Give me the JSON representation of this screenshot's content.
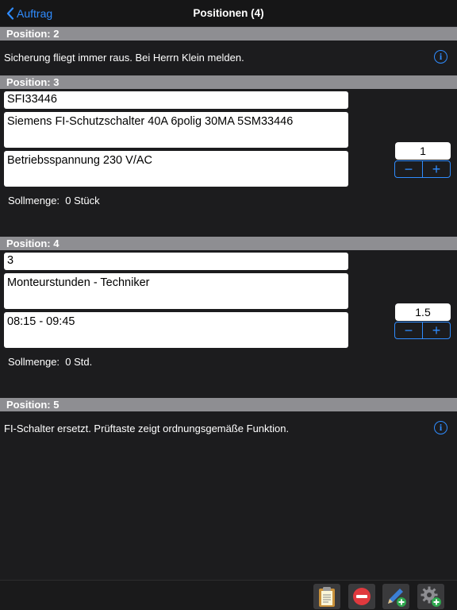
{
  "nav": {
    "back_label": "Auftrag",
    "title": "Positionen (4)"
  },
  "positions": [
    {
      "header": "Position: 2",
      "note": "Sicherung fliegt immer raus. Bei Herrn Klein melden."
    },
    {
      "header": "Position: 3",
      "article_no": "SFI33446",
      "description": "Siemens FI-Schutzschalter 40A 6polig 30MA 5SM33446",
      "detail": "Betriebsspannung 230 V/AC",
      "quantity": "1",
      "sollmenge_label": "Sollmenge:",
      "sollmenge_value": "0 Stück"
    },
    {
      "header": "Position: 4",
      "article_no": "3",
      "description": "Monteurstunden - Techniker",
      "detail": "08:15 - 09:45",
      "quantity": "1.5",
      "sollmenge_label": "Sollmenge:",
      "sollmenge_value": "0 Std."
    },
    {
      "header": "Position: 5",
      "note": "FI-Schalter ersetzt. Prüftaste zeigt ordnungsgemäße Funktion."
    }
  ],
  "stepper": {
    "minus": "−",
    "plus": "+"
  },
  "info_glyph": "i",
  "toolbar": {
    "icons": [
      "clipboard-icon",
      "remove-icon",
      "edit-add-icon",
      "settings-add-icon"
    ]
  },
  "colors": {
    "accent": "#2f8cff",
    "background": "#1c1c1e",
    "section_header": "#8e8e92",
    "remove": "#e0393e"
  }
}
